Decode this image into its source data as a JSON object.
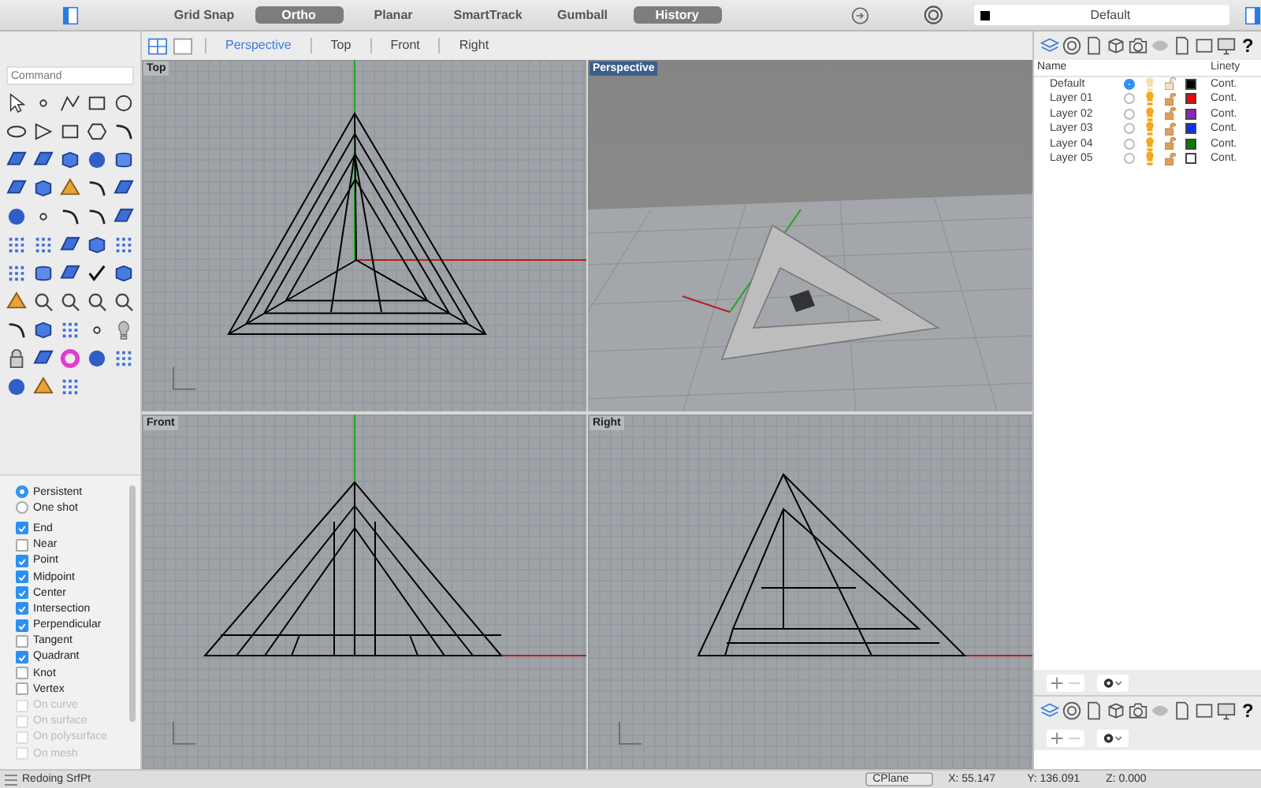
{
  "toolbar": {
    "toggles": [
      {
        "label": "Grid Snap",
        "on": false
      },
      {
        "label": "Ortho",
        "on": true
      },
      {
        "label": "Planar",
        "on": false
      },
      {
        "label": "SmartTrack",
        "on": false
      },
      {
        "label": "Gumball",
        "on": false
      },
      {
        "label": "History",
        "on": true
      }
    ],
    "layer_selector": {
      "value": "Default",
      "color": "#000000"
    }
  },
  "command": {
    "placeholder": "Command"
  },
  "viewport_tabs": [
    {
      "label": "Perspective",
      "selected": true
    },
    {
      "label": "Top",
      "selected": false
    },
    {
      "label": "Front",
      "selected": false
    },
    {
      "label": "Right",
      "selected": false
    }
  ],
  "viewports": [
    {
      "title": "Top",
      "kind": "top",
      "active": false
    },
    {
      "title": "Perspective",
      "kind": "perspective",
      "active": true
    },
    {
      "title": "Front",
      "kind": "front",
      "active": false
    },
    {
      "title": "Right",
      "kind": "right",
      "active": false
    }
  ],
  "osnap": {
    "modes": [
      {
        "label": "Persistent",
        "selected": true
      },
      {
        "label": "One shot",
        "selected": false
      }
    ],
    "snaps": [
      {
        "label": "End",
        "checked": true,
        "disabled": false
      },
      {
        "label": "Near",
        "checked": false,
        "disabled": false
      },
      {
        "label": "Point",
        "checked": true,
        "disabled": false
      },
      {
        "label": "Midpoint",
        "checked": true,
        "disabled": false
      },
      {
        "label": "Center",
        "checked": true,
        "disabled": false
      },
      {
        "label": "Intersection",
        "checked": true,
        "disabled": false
      },
      {
        "label": "Perpendicular",
        "checked": true,
        "disabled": false
      },
      {
        "label": "Tangent",
        "checked": false,
        "disabled": false
      },
      {
        "label": "Quadrant",
        "checked": true,
        "disabled": false
      },
      {
        "label": "Knot",
        "checked": false,
        "disabled": false
      },
      {
        "label": "Vertex",
        "checked": false,
        "disabled": false
      },
      {
        "label": "On curve",
        "checked": false,
        "disabled": true
      },
      {
        "label": "On surface",
        "checked": false,
        "disabled": true
      },
      {
        "label": "On polysurface",
        "checked": false,
        "disabled": true
      },
      {
        "label": "On mesh",
        "checked": false,
        "disabled": true
      }
    ]
  },
  "layers": {
    "help": "?",
    "columns": [
      "Name",
      "Linety"
    ],
    "rows": [
      {
        "name": "Default",
        "selected": true,
        "color": "#000000",
        "linetype": "Cont."
      },
      {
        "name": "Layer 01",
        "selected": false,
        "color": "#ff0000",
        "linetype": "Cont."
      },
      {
        "name": "Layer 02",
        "selected": false,
        "color": "#8e24c8",
        "linetype": "Cont."
      },
      {
        "name": "Layer 03",
        "selected": false,
        "color": "#0033ff",
        "linetype": "Cont."
      },
      {
        "name": "Layer 04",
        "selected": false,
        "color": "#008000",
        "linetype": "Cont."
      },
      {
        "name": "Layer 05",
        "selected": false,
        "color": "#ffffff",
        "linetype": "Cont."
      }
    ]
  },
  "lower_panel": {
    "help": "?"
  },
  "status_bar": {
    "message": "Redoing SrfPt",
    "cplane": "CPlane",
    "x": "X: 55.147",
    "y": "Y: 136.091",
    "z": "Z: 0.000"
  }
}
